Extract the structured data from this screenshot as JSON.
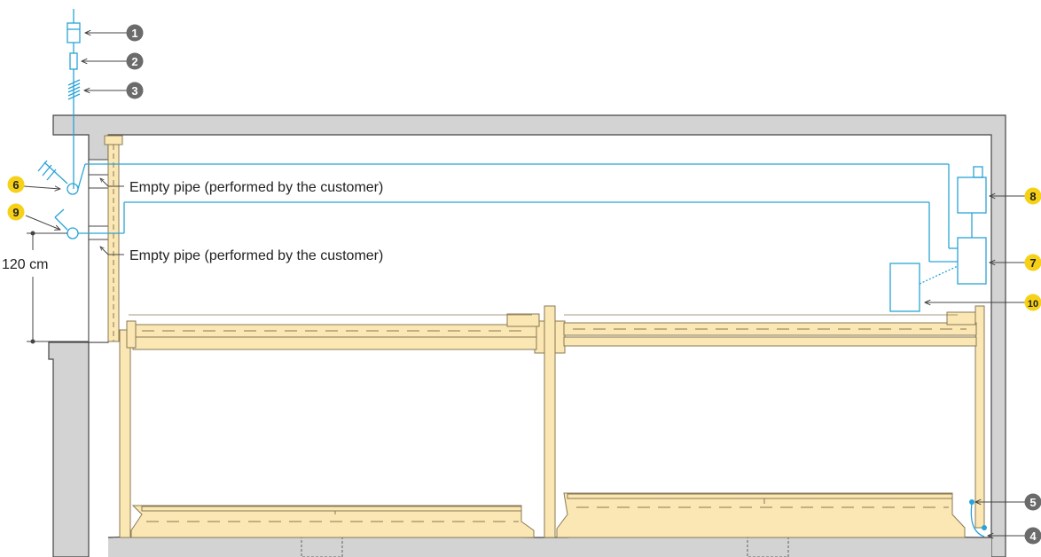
{
  "labels": {
    "pipe_upper": "Empty pipe (performed by the customer)",
    "pipe_lower": "Empty pipe (performed by the customer)",
    "height": "120 cm"
  },
  "markers": [
    {
      "id": "1",
      "text": "1",
      "style": "grey"
    },
    {
      "id": "2",
      "text": "2",
      "style": "grey"
    },
    {
      "id": "3",
      "text": "3",
      "style": "grey"
    },
    {
      "id": "4",
      "text": "4",
      "style": "grey"
    },
    {
      "id": "5",
      "text": "5",
      "style": "grey"
    },
    {
      "id": "6",
      "text": "6",
      "style": "yellow"
    },
    {
      "id": "7",
      "text": "7",
      "style": "yellow"
    },
    {
      "id": "8",
      "text": "8",
      "style": "yellow"
    },
    {
      "id": "9",
      "text": "9",
      "style": "yellow"
    },
    {
      "id": "10",
      "text": "10",
      "style": "yellow"
    }
  ],
  "colors": {
    "wall": "#d3d3d3",
    "outline": "#444444",
    "wire": "#29a3d6",
    "platform": "#fbe7b4",
    "platform_edge": "#8a7a55",
    "marker_grey": "#6b6b6b",
    "marker_yellow": "#f7d117",
    "text": "#222222"
  }
}
